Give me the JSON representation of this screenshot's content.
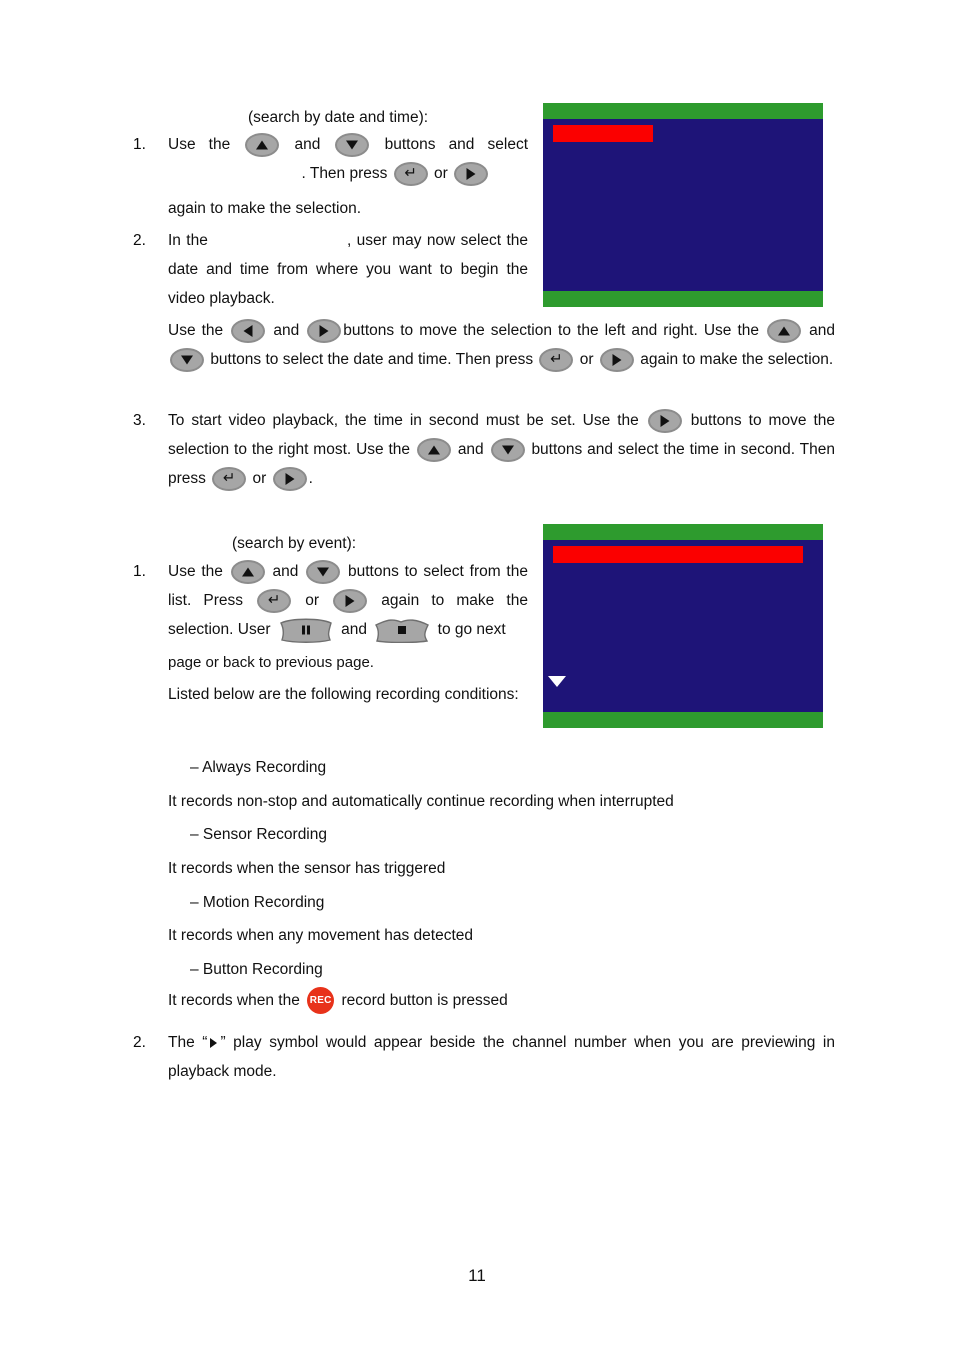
{
  "document": {
    "page_number": "11"
  },
  "colors": {
    "screen_background": "#1e1478",
    "screen_bar": "#2e9b2e",
    "screen_highlight": "#fb0000",
    "button_face": "#a6a6a6",
    "button_border": "#8c8c8c",
    "rec_button": "#e8321a"
  },
  "section_date_time": {
    "heading": "(search by date and time):",
    "step1": {
      "number": "1.",
      "part_a": "Use the",
      "part_b": "and",
      "part_c": "buttons and select",
      "part_d": ". Then press",
      "part_e": "or",
      "part_f": "again to make the selection."
    },
    "step2": {
      "number": "2.",
      "part_a": "In the",
      "part_b": ", user may now select the date and time from where you want to begin the video playback."
    },
    "paragraph": {
      "part_a": "Use the",
      "part_b": "and",
      "part_c": "buttons to move the selection to the left and right. Use the",
      "part_d": "and",
      "part_e": "buttons to select the date and time. Then press",
      "part_f": "or",
      "part_g": "again to make the selection."
    },
    "step3": {
      "number": "3.",
      "part_a": "To start video playback, the time in second must be set. Use the",
      "part_b": "buttons to move the selection to the right most. Use the",
      "part_c": "and",
      "part_d": "buttons and select the time in second. Then press",
      "part_e": "or",
      "part_f": "."
    }
  },
  "section_event": {
    "heading": "(search by event):",
    "step1": {
      "number": "1.",
      "part_a": "Use the",
      "part_b": "and",
      "part_c": "buttons to select from the list. Press",
      "part_d": "or",
      "part_e": "again to make the selection. User",
      "part_f": "and",
      "part_g": "to go next",
      "part_h": "page or back to previous page."
    },
    "listed_intro": "Listed below are the following recording conditions:",
    "conditions": [
      {
        "title": "– Always Recording",
        "description": "It records non-stop and automatically continue recording when interrupted"
      },
      {
        "title": "– Sensor Recording",
        "description": "It records when the sensor has triggered"
      },
      {
        "title": "– Motion Recording",
        "description": "It records when any movement has detected"
      },
      {
        "title": "– Button Recording",
        "description_before": "It records when the",
        "rec_label": "REC",
        "description_after": "record button is pressed"
      }
    ],
    "step2": {
      "number": "2.",
      "part_a": "The “",
      "part_b": "” play symbol would appear beside the channel number when you are previewing in playback mode."
    }
  },
  "screenshots": {
    "date_time_menu": {
      "name": "DVR search by date and time menu screen"
    },
    "event_menu": {
      "name": "DVR search by event list screen"
    }
  }
}
